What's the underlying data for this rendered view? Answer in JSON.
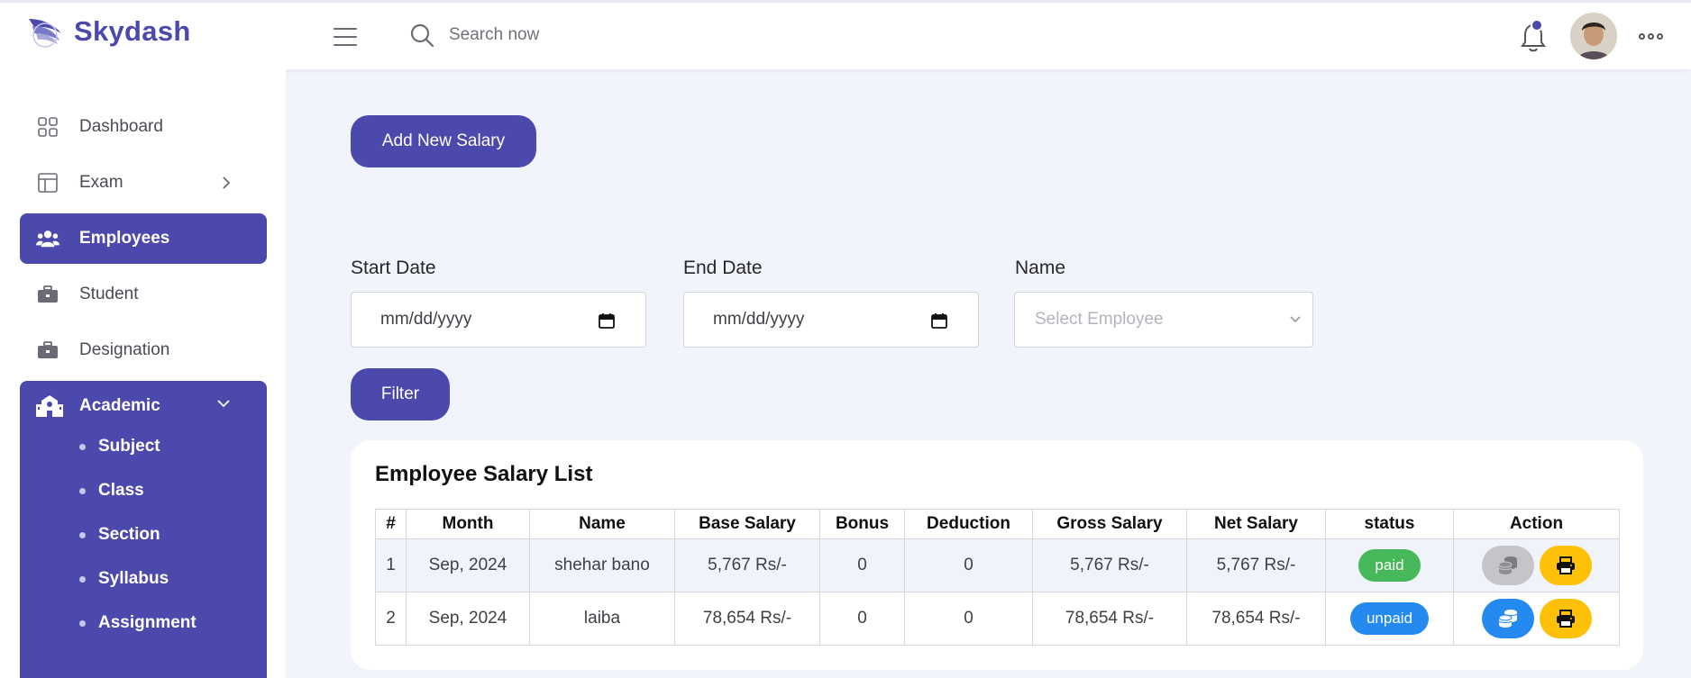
{
  "brand": {
    "name": "Skydash"
  },
  "search": {
    "placeholder": "Search now"
  },
  "sidebar": {
    "items": [
      {
        "label": "Dashboard"
      },
      {
        "label": "Exam"
      },
      {
        "label": "Employees"
      },
      {
        "label": "Student"
      },
      {
        "label": "Designation"
      },
      {
        "label": "Academic"
      }
    ],
    "academic_sub": [
      {
        "label": "Subject"
      },
      {
        "label": "Class"
      },
      {
        "label": "Section"
      },
      {
        "label": "Syllabus"
      },
      {
        "label": "Assignment"
      }
    ]
  },
  "main": {
    "add_button": "Add New Salary",
    "filters": {
      "start_label": "Start Date",
      "start_value": "mm/dd/yyyy",
      "end_label": "End Date",
      "end_value": "mm/dd/yyyy",
      "name_label": "Name",
      "name_placeholder": "Select Employee",
      "filter_button": "Filter"
    },
    "table": {
      "title": "Employee Salary List",
      "headers": [
        "#",
        "Month",
        "Name",
        "Base Salary",
        "Bonus",
        "Deduction",
        "Gross Salary",
        "Net Salary",
        "status",
        "Action"
      ],
      "rows": [
        {
          "num": "1",
          "month": "Sep, 2024",
          "name": "shehar bano",
          "base": "5,767 Rs/-",
          "bonus": "0",
          "deduction": "0",
          "gross": "5,767 Rs/-",
          "net": "5,767 Rs/-",
          "status": "paid"
        },
        {
          "num": "2",
          "month": "Sep, 2024",
          "name": "laiba",
          "base": "78,654 Rs/-",
          "bonus": "0",
          "deduction": "0",
          "gross": "78,654 Rs/-",
          "net": "78,654 Rs/-",
          "status": "unpaid"
        }
      ]
    }
  },
  "colors": {
    "primary": "#4b49ac",
    "paid": "#47b85a",
    "unpaid": "#248af0",
    "print": "#ffc107"
  }
}
